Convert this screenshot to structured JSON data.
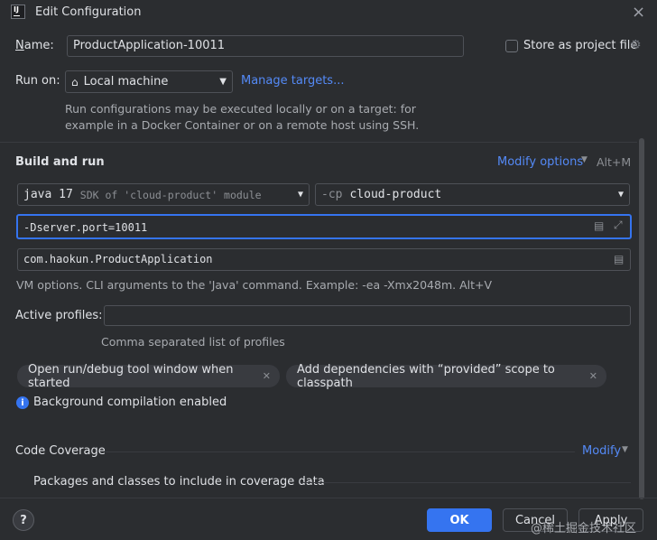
{
  "window": {
    "title": "Edit Configuration",
    "app_icon_text": "IJ"
  },
  "name_field": {
    "label": "Name:",
    "value": "ProductApplication-10011"
  },
  "store_project": {
    "label": "Store as project file"
  },
  "run_on": {
    "label": "Run on:",
    "value": "Local machine",
    "manage_targets": "Manage targets...",
    "hint_line1": "Run configurations may be executed locally or on a target: for",
    "hint_line2": "example in a Docker Container or on a remote host using SSH."
  },
  "build_run": {
    "heading": "Build and run",
    "modify_options": "Modify options",
    "modify_shortcut": "Alt+M",
    "jdk_version": "java 17",
    "jdk_desc": "SDK of 'cloud-product' module",
    "cp_flag": "-cp",
    "cp_value": "cloud-product",
    "vm_options": "-Dserver.port=10011",
    "main_class": "com.haokun.ProductApplication",
    "hint": "VM options. CLI arguments to the 'Java' command. Example: -ea -Xmx2048m. Alt+V"
  },
  "active_profiles": {
    "label": "Active profiles:",
    "value": "",
    "hint": "Comma separated list of profiles"
  },
  "chips": [
    "Open run/debug tool window when started",
    "Add dependencies with “provided” scope to classpath"
  ],
  "info": {
    "text": "Background compilation enabled"
  },
  "coverage": {
    "heading": "Code Coverage",
    "modify": "Modify",
    "packages": "Packages and classes to include in coverage data"
  },
  "buttons": {
    "help": "?",
    "ok": "OK",
    "cancel": "Cancel",
    "apply": "Apply"
  },
  "watermark": "@稀土掘金技术社区"
}
